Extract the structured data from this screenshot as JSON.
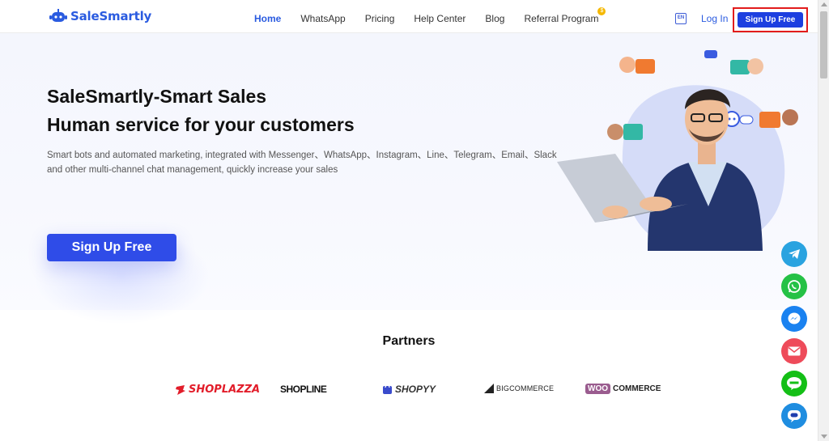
{
  "header": {
    "logo_text": "SaleSmartly",
    "nav": [
      {
        "label": "Home",
        "active": true
      },
      {
        "label": "WhatsApp"
      },
      {
        "label": "Pricing"
      },
      {
        "label": "Help Center"
      },
      {
        "label": "Blog"
      },
      {
        "label": "Referral Program",
        "badge": "$"
      }
    ],
    "lang_label": "EN",
    "login_label": "Log In",
    "signup_label": "Sign Up Free"
  },
  "hero": {
    "title_line1": "SaleSmartly-Smart Sales",
    "title_line2": "Human service for your customers",
    "description": "Smart bots and automated marketing, integrated with Messenger、WhatsApp、Instagram、Line、Telegram、Email、Slack and other multi-channel chat management, quickly increase your sales",
    "cta_label": "Sign Up Free"
  },
  "partners": {
    "title": "Partners",
    "logos": [
      "SHOPLAZZA",
      "SHOPLINE",
      "SHOPYY",
      "BIGCOMMERCE",
      "WOO",
      "COMMERCE"
    ]
  },
  "social": [
    {
      "name": "telegram-icon",
      "color": "#2aa3e0"
    },
    {
      "name": "whatsapp-icon",
      "color": "#25c146"
    },
    {
      "name": "messenger-icon",
      "color": "#1a82f0"
    },
    {
      "name": "email-icon",
      "color": "#ee4b5a"
    },
    {
      "name": "line-icon",
      "color": "#14bf16"
    },
    {
      "name": "chat-icon",
      "color": "#1f8de0"
    }
  ],
  "colors": {
    "brand": "#2a5be0",
    "cta": "#2f4ce8",
    "highlight_border": "#e21c1c"
  }
}
